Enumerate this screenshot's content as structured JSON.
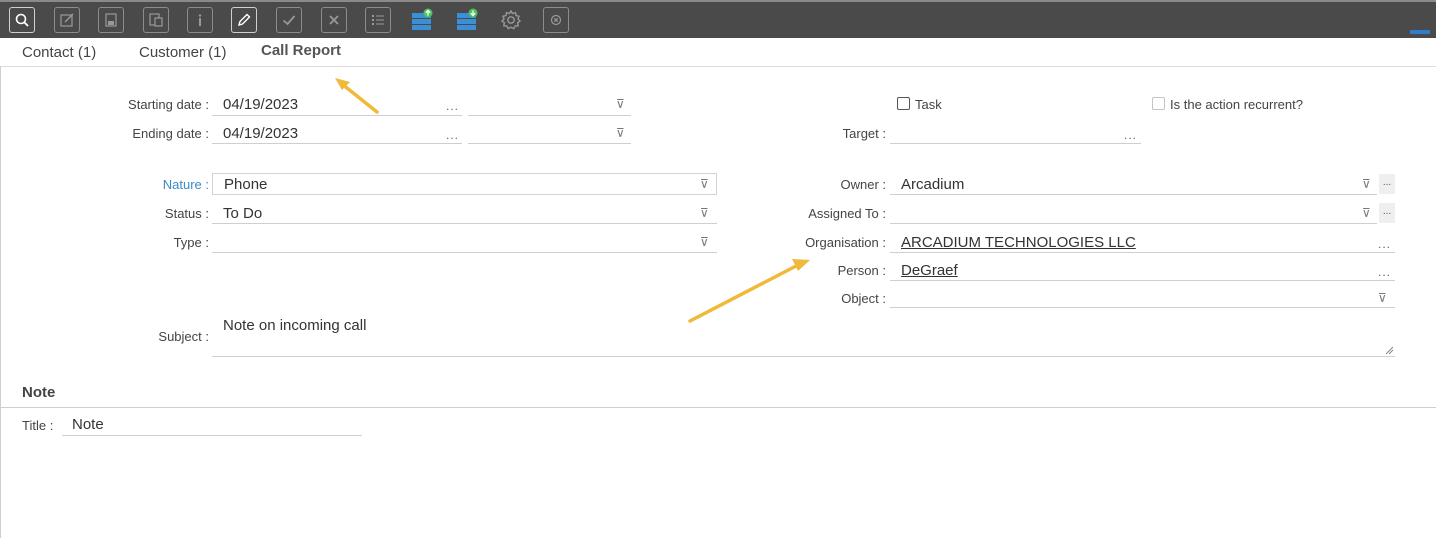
{
  "toolbar": {
    "buttons": [
      {
        "name": "search-icon"
      },
      {
        "name": "edit-form-icon"
      },
      {
        "name": "save-icon"
      },
      {
        "name": "copy-icon"
      },
      {
        "name": "info-icon"
      },
      {
        "name": "pencil-icon"
      },
      {
        "name": "check-icon"
      },
      {
        "name": "close-icon"
      },
      {
        "name": "list-icon"
      },
      {
        "name": "database-upload-icon"
      },
      {
        "name": "database-download-icon"
      },
      {
        "name": "gear-icon"
      },
      {
        "name": "cancel-circle-icon"
      }
    ],
    "accent_color": "#2f7ec9"
  },
  "tabs": [
    {
      "label": "Contact (1)"
    },
    {
      "label": "Customer (1)"
    },
    {
      "label": "Call Report"
    }
  ],
  "form": {
    "starting_date": {
      "label": "Starting date :",
      "value": "04/19/2023",
      "dots": "..."
    },
    "ending_date": {
      "label": "Ending date :",
      "value": "04/19/2023",
      "dots": "..."
    },
    "task": {
      "label": "Task",
      "checked": false
    },
    "recurrent": {
      "label": "Is the action recurrent?",
      "checked": false,
      "disabled": true
    },
    "target": {
      "label": "Target :",
      "value": "",
      "dots": "..."
    },
    "nature": {
      "label": "Nature :",
      "value": "Phone"
    },
    "status": {
      "label": "Status :",
      "value": "To Do"
    },
    "type": {
      "label": "Type :",
      "value": ""
    },
    "owner": {
      "label": "Owner :",
      "value": "Arcadium",
      "dots": "..."
    },
    "assigned_to": {
      "label": "Assigned To :",
      "value": "",
      "dots": "..."
    },
    "organisation": {
      "label": "Organisation :",
      "value": "ARCADIUM TECHNOLOGIES LLC",
      "dots": "..."
    },
    "person": {
      "label": "Person :",
      "value": "DeGraef",
      "dots": "..."
    },
    "object": {
      "label": "Object :",
      "value": ""
    },
    "subject": {
      "label": "Subject :",
      "value": "Note on incoming call"
    }
  },
  "note": {
    "section_title": "Note",
    "title": {
      "label": "Title :",
      "value": "Note"
    }
  },
  "colors": {
    "annotation_arrow": "#f0b93a",
    "nature_label": "#3a8bc8"
  }
}
